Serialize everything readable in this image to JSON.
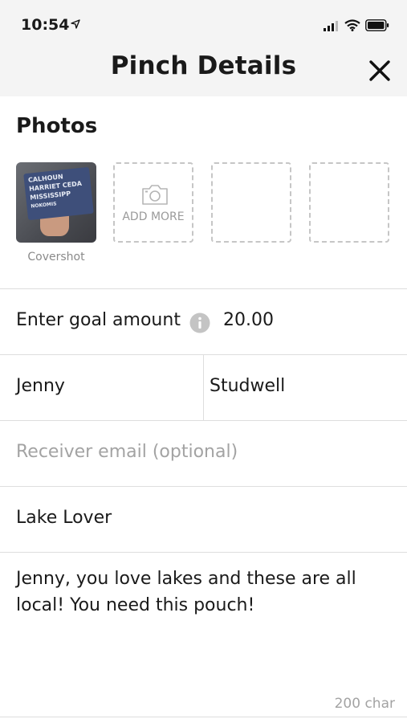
{
  "status_bar": {
    "time": "10:54"
  },
  "header": {
    "title": "Pinch Details"
  },
  "photos": {
    "heading": "Photos",
    "cover_pouch_text": [
      "CALHOUN",
      "HARRIET CEDA",
      "MISSISSIPP",
      "NOKOMIS"
    ],
    "cover_label": "Covershot",
    "add_more_label": "ADD MORE"
  },
  "form": {
    "goal_label": "Enter goal amount",
    "goal_value": "20.00",
    "first_name": "Jenny",
    "last_name": "Studwell",
    "email_placeholder": "Receiver email (optional)",
    "title_value": "Lake Lover",
    "message_value": "Jenny, you love lakes and these are all local! You need this pouch!",
    "char_counter": "200 char"
  },
  "icons": {
    "close": "close-icon",
    "info": "info-icon",
    "camera": "camera-icon",
    "location": "location-arrow-icon",
    "signal": "cellular-signal-icon",
    "wifi": "wifi-icon",
    "battery": "battery-icon"
  }
}
